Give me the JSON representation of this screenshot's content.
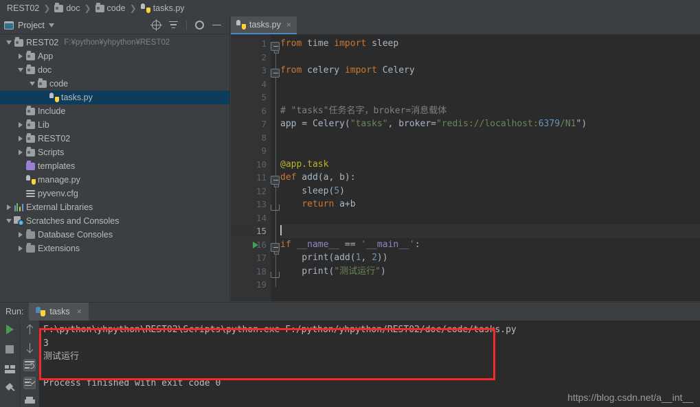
{
  "breadcrumb": [
    {
      "label": "REST02",
      "icon": "none"
    },
    {
      "label": "doc",
      "icon": "folder-icon"
    },
    {
      "label": "code",
      "icon": "folder-icon"
    },
    {
      "label": "tasks.py",
      "icon": "python-file-icon"
    }
  ],
  "sidebar": {
    "title": "Project",
    "window_icon": "project-window-icon",
    "tools": [
      {
        "name": "locate-icon"
      },
      {
        "name": "collapse-all-icon"
      },
      {
        "name": "gear-icon"
      },
      {
        "name": "hide-icon"
      }
    ],
    "items": [
      {
        "label": "REST02",
        "sublabel": "F:¥python¥yhpython¥REST02",
        "icon": "folder-icon",
        "arrow": "down",
        "indent": 0,
        "selected": false
      },
      {
        "label": "App",
        "sublabel": "",
        "icon": "folder-icon",
        "arrow": "right",
        "indent": 1,
        "selected": false
      },
      {
        "label": "doc",
        "sublabel": "",
        "icon": "folder-icon",
        "arrow": "down",
        "indent": 1,
        "selected": false
      },
      {
        "label": "code",
        "sublabel": "",
        "icon": "folder-icon",
        "arrow": "down",
        "indent": 2,
        "selected": false
      },
      {
        "label": "tasks.py",
        "sublabel": "",
        "icon": "python-file-icon",
        "arrow": "none",
        "indent": 3,
        "selected": true
      },
      {
        "label": "Include",
        "sublabel": "",
        "icon": "folder-icon",
        "arrow": "none",
        "indent": 1,
        "selected": false
      },
      {
        "label": "Lib",
        "sublabel": "",
        "icon": "folder-icon",
        "arrow": "right",
        "indent": 1,
        "selected": false
      },
      {
        "label": "REST02",
        "sublabel": "",
        "icon": "folder-icon",
        "arrow": "right",
        "indent": 1,
        "selected": false
      },
      {
        "label": "Scripts",
        "sublabel": "",
        "icon": "folder-icon",
        "arrow": "right",
        "indent": 1,
        "selected": false
      },
      {
        "label": "templates",
        "sublabel": "",
        "icon": "folder-purple-icon",
        "arrow": "none",
        "indent": 1,
        "selected": false
      },
      {
        "label": "manage.py",
        "sublabel": "",
        "icon": "python-file-icon",
        "arrow": "none",
        "indent": 1,
        "selected": false
      },
      {
        "label": "pyvenv.cfg",
        "sublabel": "",
        "icon": "config-file-icon",
        "arrow": "none",
        "indent": 1,
        "selected": false
      },
      {
        "label": "External Libraries",
        "sublabel": "",
        "icon": "libraries-icon",
        "arrow": "right",
        "indent": 0,
        "selected": false
      },
      {
        "label": "Scratches and Consoles",
        "sublabel": "",
        "icon": "scratches-icon",
        "arrow": "down",
        "indent": 0,
        "selected": false
      },
      {
        "label": "Database Consoles",
        "sublabel": "",
        "icon": "folder-gray-icon",
        "arrow": "right",
        "indent": 1,
        "selected": false
      },
      {
        "label": "Extensions",
        "sublabel": "",
        "icon": "folder-gray-icon",
        "arrow": "right",
        "indent": 1,
        "selected": false
      }
    ]
  },
  "editor": {
    "tab": {
      "label": "tasks.py",
      "icon": "python-file-icon",
      "close": "×",
      "active": true
    },
    "cursor_line": 15,
    "run_marker_line": 16,
    "total_lines": 19,
    "lines": [
      {
        "n": 1,
        "text": "from time import sleep"
      },
      {
        "n": 2,
        "text": ""
      },
      {
        "n": 3,
        "text": "from celery import Celery"
      },
      {
        "n": 4,
        "text": ""
      },
      {
        "n": 5,
        "text": ""
      },
      {
        "n": 6,
        "text": "# \"tasks\"任务名字，broker=消息载体"
      },
      {
        "n": 7,
        "text": "app = Celery(\"tasks\", broker=\"redis://localhost:6379/1\")"
      },
      {
        "n": 8,
        "text": ""
      },
      {
        "n": 9,
        "text": ""
      },
      {
        "n": 10,
        "text": "@app.task"
      },
      {
        "n": 11,
        "text": "def add(a, b):"
      },
      {
        "n": 12,
        "text": "    sleep(5)"
      },
      {
        "n": 13,
        "text": "    return a+b"
      },
      {
        "n": 14,
        "text": ""
      },
      {
        "n": 15,
        "text": ""
      },
      {
        "n": 16,
        "text": "if __name__ == '__main__':"
      },
      {
        "n": 17,
        "text": "    print(add(1, 2))"
      },
      {
        "n": 18,
        "text": "    print(\"测试运行\")"
      },
      {
        "n": 19,
        "text": ""
      }
    ]
  },
  "run_window": {
    "label": "Run:",
    "tab": {
      "label": "tasks",
      "icon": "python-file-icon",
      "close": "×"
    },
    "toolbar_left": [
      {
        "name": "rerun-button",
        "icon": "play-icon"
      },
      {
        "name": "stop-button",
        "icon": "stop-icon"
      },
      {
        "name": "layout-button",
        "icon": "layout-icon"
      },
      {
        "name": "pin-button",
        "icon": "pin-icon"
      }
    ],
    "toolbar_right": [
      {
        "name": "up-button",
        "icon": "arrow-up-icon"
      },
      {
        "name": "down-button",
        "icon": "arrow-down-icon"
      },
      {
        "name": "soft-wrap-button",
        "icon": "soft-wrap-icon",
        "active": true
      },
      {
        "name": "scroll-to-end-button",
        "icon": "scroll-to-end-icon",
        "active": true
      },
      {
        "name": "print-button",
        "icon": "printer-icon"
      }
    ],
    "console_lines": [
      "F:\\python\\yhpython\\REST02\\Scripts\\python.exe F:/python/yhpython/REST02/doc/code/tasks.py",
      "3",
      "测试运行",
      "",
      "Process finished with exit code 0"
    ]
  },
  "annotation": {
    "name": "red-highlight-box",
    "color": "#f5292b"
  },
  "watermark": "https://blog.csdn.net/a__int__"
}
